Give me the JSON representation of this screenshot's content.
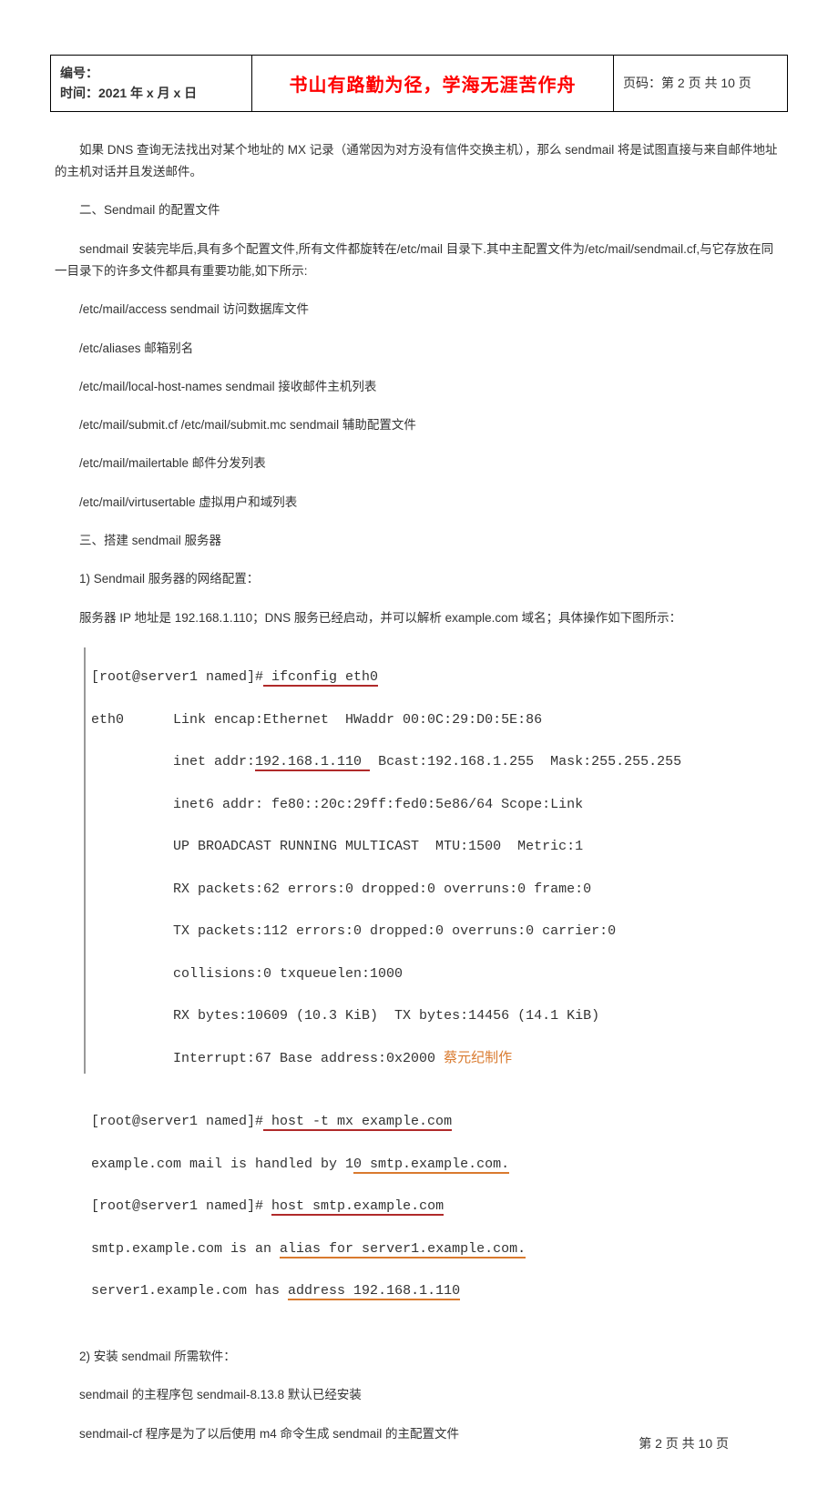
{
  "header": {
    "id_label": "编号：",
    "time_label": "时间：",
    "time_value": "2021 年 x 月 x 日",
    "motto": "书山有路勤为径，学海无涯苦作舟",
    "page_label": "页码：",
    "page_value": "第 2 页  共 10 页"
  },
  "body": {
    "p1": "如果 DNS 查询无法找出对某个地址的 MX 记录（通常因为对方没有信件交换主机），那么 sendmail 将是试图直接与来自邮件地址的主机对话并且发送邮件。",
    "p2": "二、Sendmail 的配置文件",
    "p3": "sendmail 安装完毕后,具有多个配置文件,所有文件都旋转在/etc/mail 目录下.其中主配置文件为/etc/mail/sendmail.cf,与它存放在同一目录下的许多文件都具有重要功能,如下所示:",
    "p4": "/etc/mail/access sendmail 访问数据库文件",
    "p5": "/etc/aliases 邮箱别名",
    "p6": "/etc/mail/local-host-names sendmail 接收邮件主机列表",
    "p7": "/etc/mail/submit.cf  /etc/mail/submit.mc sendmail 辅助配置文件",
    "p8": "/etc/mail/mailertable 邮件分发列表",
    "p9": "/etc/mail/virtusertable 虚拟用户和域列表",
    "p10": "三、搭建 sendmail 服务器",
    "p11": "1) Sendmail 服务器的网络配置：",
    "p12": "服务器 IP 地址是 192.168.1.110；DNS 服务已经启动，并可以解析 example.com 域名；具体操作如下图所示：",
    "p13": "2) 安装 sendmail 所需软件：",
    "p14": "sendmail 的主程序包 sendmail-8.13.8 默认已经安装",
    "p15": "sendmail-cf 程序是为了以后使用 m4 命令生成 sendmail 的主配置文件"
  },
  "terminal": {
    "l1a": "[root@server1 named]#",
    "l1b": " ifconfig eth0",
    "l2": "eth0      Link encap:Ethernet  HWaddr 00:0C:29:D0:5E:86",
    "l3a": "          inet addr:",
    "l3b": "192.168.1.110 ",
    "l3c": " Bcast:192.168.1.255  Mask:255.255.255",
    "l4": "          inet6 addr: fe80::20c:29ff:fed0:5e86/64 Scope:Link",
    "l5": "          UP BROADCAST RUNNING MULTICAST  MTU:1500  Metric:1",
    "l6": "          RX packets:62 errors:0 dropped:0 overruns:0 frame:0",
    "l7": "          TX packets:112 errors:0 dropped:0 overruns:0 carrier:0",
    "l8": "          collisions:0 txqueuelen:1000",
    "l9": "          RX bytes:10609 (10.3 KiB)  TX bytes:14456 (14.1 KiB)",
    "l10a": "          Interrupt:67 Base address:0x2000 ",
    "l10b": "蔡元纪制作",
    "blank": "",
    "l11a": "[root@server1 named]#",
    "l11b": " host -t mx example.com",
    "l12a": "example.com mail is handled by 1",
    "l12b": "0 smtp.example.com.",
    "l13a": "[root@server1 named]# ",
    "l13b": "host smtp.example.com",
    "l14a": "smtp.example.com is an ",
    "l14b": "alias for server1.example.com.",
    "l15a": "server1.example.com has ",
    "l15b": "address 192.168.1.110"
  },
  "footer": {
    "text": "第  2  页  共  10  页"
  }
}
